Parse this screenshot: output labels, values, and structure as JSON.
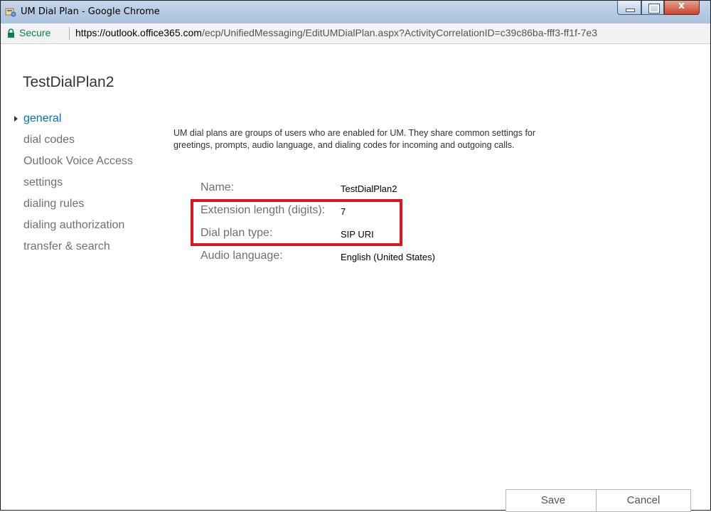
{
  "window": {
    "title": "UM Dial Plan - Google Chrome",
    "close_glyph": "x"
  },
  "addressbar": {
    "secure_label": "Secure",
    "url_host": "https://outlook.office365.com",
    "url_path": "/ecp/UnifiedMessaging/EditUMDialPlan.aspx?ActivityCorrelationID=c39c86ba-fff3-ff1f-7e3"
  },
  "page": {
    "title": "TestDialPlan2",
    "description": "UM dial plans are groups of users who are enabled for UM. They share common settings for greetings, prompts, audio language, and dialing codes for incoming and outgoing calls."
  },
  "nav": {
    "items": [
      {
        "label": "general",
        "active": true
      },
      {
        "label": "dial codes",
        "active": false
      },
      {
        "label": "Outlook Voice Access",
        "active": false
      },
      {
        "label": "settings",
        "active": false
      },
      {
        "label": "dialing rules",
        "active": false
      },
      {
        "label": "dialing authorization",
        "active": false
      },
      {
        "label": "transfer & search",
        "active": false
      }
    ]
  },
  "fields": {
    "name": {
      "label": "Name:",
      "value": "TestDialPlan2"
    },
    "extension_length": {
      "label": "Extension length (digits):",
      "value": "7"
    },
    "dial_plan_type": {
      "label": "Dial plan type:",
      "value": "SIP URI"
    },
    "audio_language": {
      "label": "Audio language:",
      "value": "English (United States)"
    }
  },
  "buttons": {
    "save": "Save",
    "cancel": "Cancel"
  },
  "colors": {
    "accent": "#0072c6",
    "secure": "#0b8043",
    "highlight": "#e0141e"
  },
  "icons": {
    "app": "um-dialplan-icon",
    "lock": "lock-icon",
    "nav_active": "triangle-right-icon"
  }
}
